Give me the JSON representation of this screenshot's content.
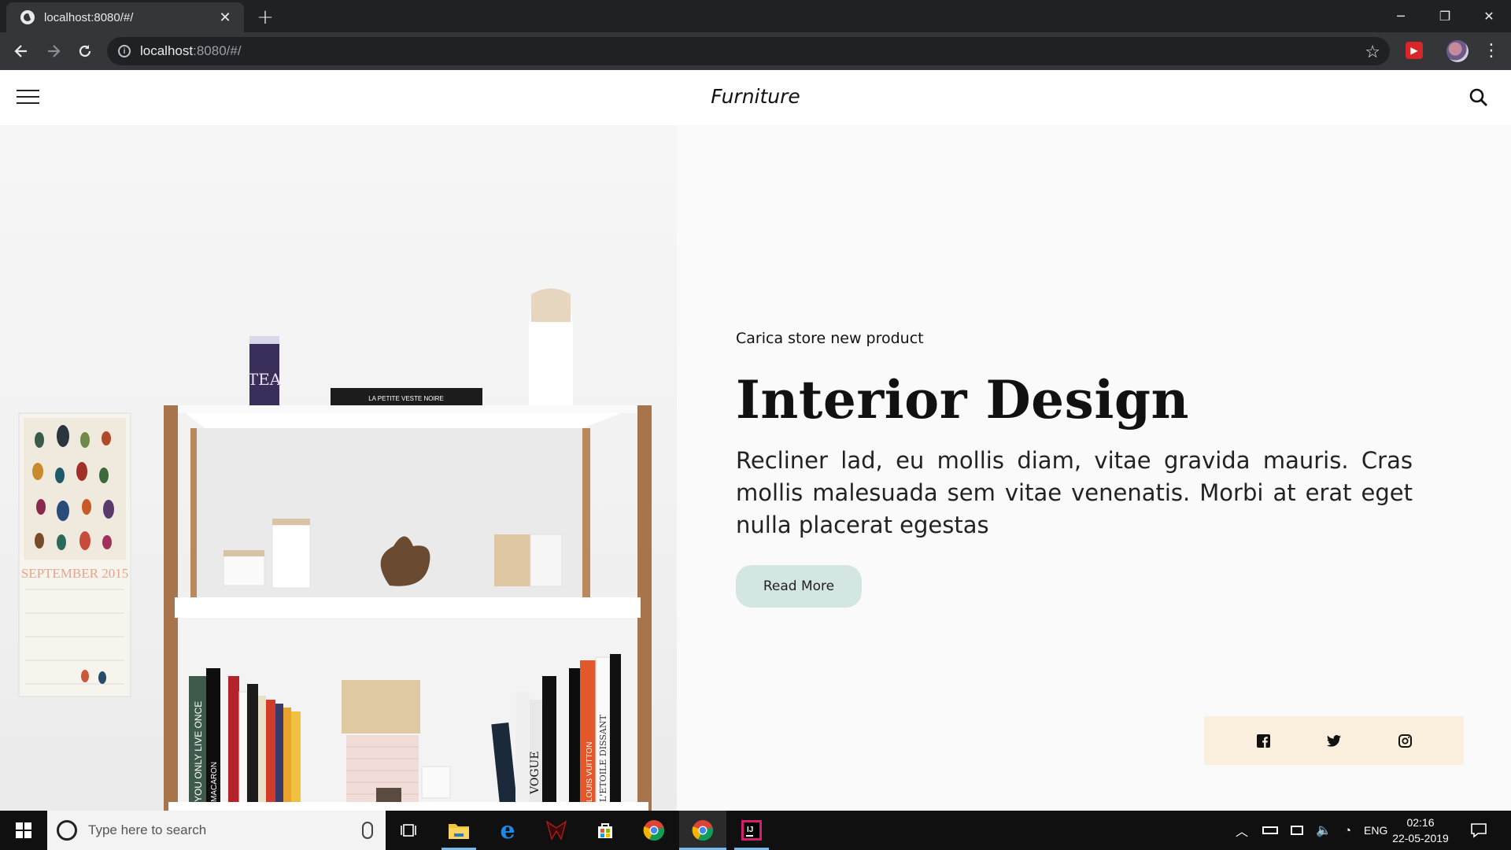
{
  "browser": {
    "tab_title": "localhost:8080/#/",
    "tab_close": "✕",
    "new_tab": "+",
    "url_host": "localhost",
    "url_rest": ":8080/#/",
    "window_minimize": "─",
    "window_restore": "❐",
    "window_close": "✕"
  },
  "site": {
    "logo": "Furniture"
  },
  "hero": {
    "eyebrow": "Carica store new product",
    "headline": "Interior Design",
    "body": "Recliner lad, eu mollis diam, vitae gravida mauris. Cras mollis malesuada sem vitae venenatis. Morbi at erat eget nulla placerat egestas",
    "cta_label": "Read More"
  },
  "artwork": {
    "tea_label": "TEA",
    "book_title": "LA PETITE VESTE NOIRE",
    "calendar_label": "SEPTEMBER 2015",
    "spine_1": "YOU ONLY LIVE ONCE",
    "spine_2": "MACARON",
    "spine_3": "VOGUE",
    "spine_4": "LOUIS VUITTON",
    "spine_5": "L'ETOILE DISSANT"
  },
  "social": [
    "facebook-icon",
    "twitter-icon",
    "instagram-icon"
  ],
  "taskbar": {
    "search_placeholder": "Type here to search",
    "lang": "ENG",
    "time": "02:16",
    "date": "22-05-2019"
  },
  "colors": {
    "cta_bg": "#d3e6e3",
    "social_bg": "#fbf0de",
    "chrome_dark": "#202124",
    "chrome_toolbar": "#35363a"
  }
}
